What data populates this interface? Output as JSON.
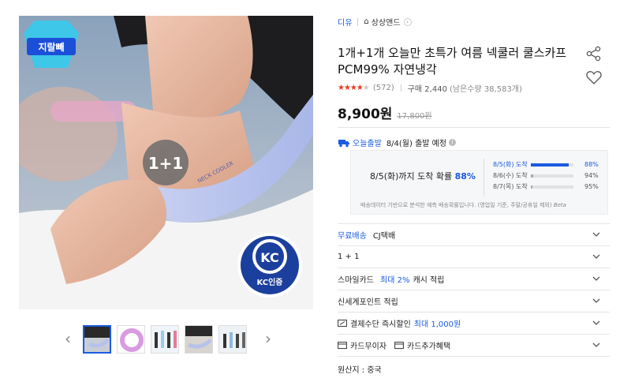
{
  "breadcrumb": {
    "brand": "디유",
    "shop": "상상앤드"
  },
  "product": {
    "title": "1개+1개 오늘만 초특가 여름 넥쿨러 쿨스카프 PCM99% 자연냉각",
    "rating": 4.5,
    "review_count": "(572)",
    "purchase_label": "구매 2,440",
    "remaining": "(남은수량 38,583개)",
    "price": "8,900원",
    "original_price": "17,800원"
  },
  "image": {
    "badge": "1+1",
    "kc_label": "KC인증",
    "neck_text": "NECK COOLER",
    "corner_text": "지랄빼"
  },
  "shipping": {
    "today_label": "오늘출발",
    "dispatch": "8/4(월) 출발 예정",
    "arrival_prefix": "8/5(화)까지 도착 확률",
    "arrival_pct": "88%",
    "distribution": [
      {
        "day": "8/5(화) 도착",
        "pct": "88%",
        "ratio": 0.88
      },
      {
        "day": "8/6(수) 도착",
        "pct": "94%",
        "ratio": 0.06
      },
      {
        "day": "8/7(목) 도착",
        "pct": "95%",
        "ratio": 0.01
      }
    ],
    "note": "배송데이터 기반으로 분석한 예측 배송확률입니다. (영업일 기준, 주말/공휴일 제외)",
    "note_tag": "Beta"
  },
  "options": {
    "free_ship": "무료배송",
    "carrier": "CJ택배",
    "bundle": "1 + 1",
    "smile_card_prefix": "스마일카드",
    "smile_card_highlight": "최대 2%",
    "smile_card_suffix": "캐시 적립",
    "shinsegae": "신세계포인트 적립",
    "instant_discount": "결제수단 즉시할인",
    "instant_discount_max": "최대 1,000원",
    "interest_free": "카드무이자",
    "card_benefit": "카드추가혜택",
    "origin": "원산지 : 중국"
  },
  "colors": {
    "accent": "#1a5be0",
    "star": "#ea3b1f"
  }
}
